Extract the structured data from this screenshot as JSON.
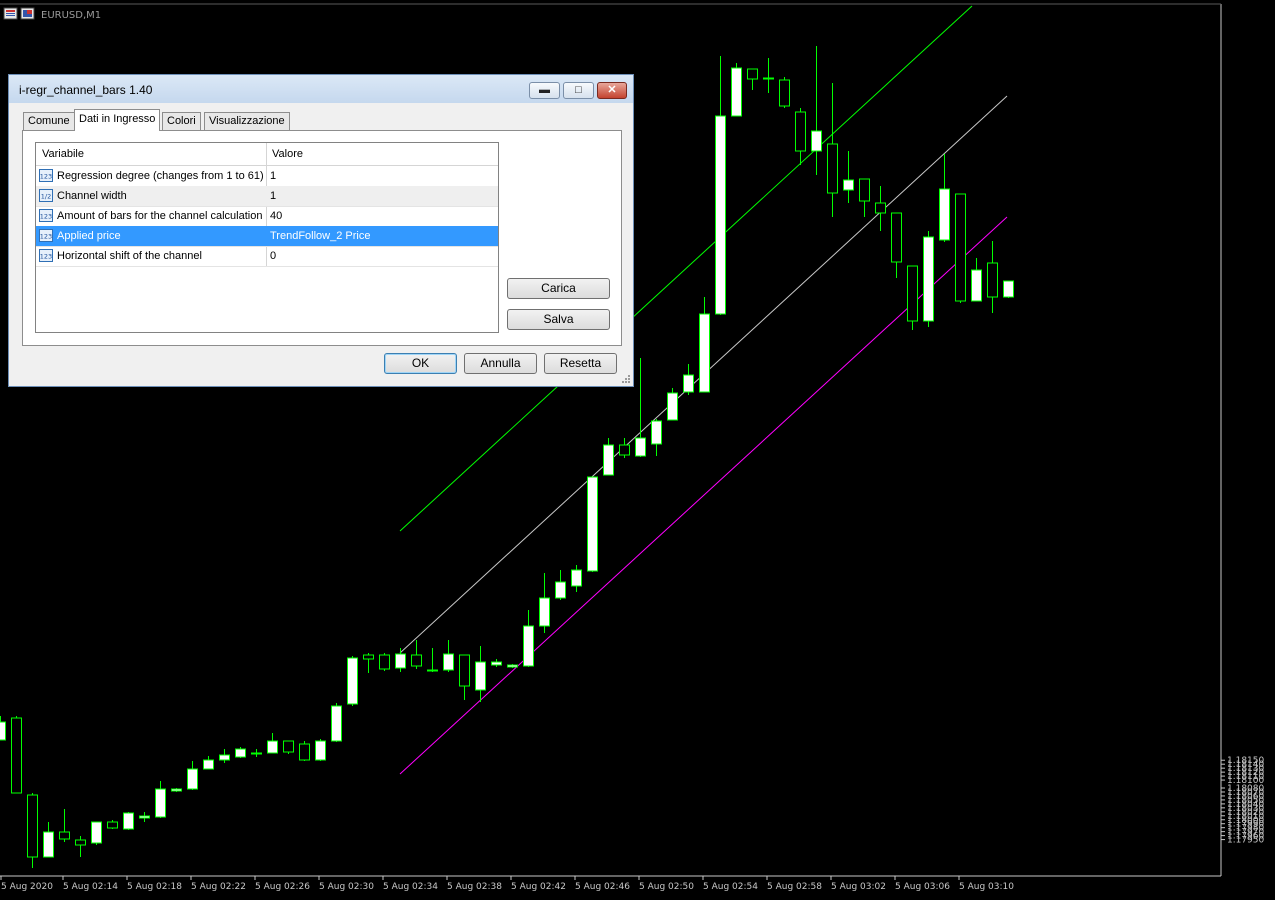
{
  "chart": {
    "symbol": "EURUSD,M1",
    "price_labels": [
      "1.18150",
      "1.18140",
      "1.18130",
      "1.18120",
      "1.18110",
      "1.18100",
      "1.18080",
      "1.18070",
      "1.18060",
      "1.18050",
      "1.18040",
      "1.18030",
      "1.18020",
      "1.18010",
      "1.18000",
      "1.17990",
      "1.17980",
      "1.17970",
      "1.17960",
      "1.17950"
    ],
    "time_labels": [
      "5 Aug 2020",
      "5 Aug 02:14",
      "5 Aug 02:18",
      "5 Aug 02:22",
      "5 Aug 02:26",
      "5 Aug 02:30",
      "5 Aug 02:34",
      "5 Aug 02:38",
      "5 Aug 02:42",
      "5 Aug 02:46",
      "5 Aug 02:50",
      "5 Aug 02:54",
      "5 Aug 02:58",
      "5 Aug 03:02",
      "5 Aug 03:06",
      "5 Aug 03:10"
    ],
    "colors": {
      "background": "#000000",
      "bull_body": "#ffffff",
      "bear_body": "#000000",
      "wick": "#00ff00",
      "channel_upper": "#00ff00",
      "channel_middle": "#c8c8c8",
      "channel_lower": "#ff00ff",
      "axis": "#c8c8c8"
    }
  },
  "dialog": {
    "title": "i-regr_channel_bars 1.40",
    "tabs": [
      {
        "label": "Comune"
      },
      {
        "label": "Dati in Ingresso"
      },
      {
        "label": "Colori"
      },
      {
        "label": "Visualizzazione"
      }
    ],
    "active_tab": "Dati in Ingresso",
    "table": {
      "headers": [
        "Variabile",
        "Valore"
      ],
      "rows": [
        {
          "icon": "123",
          "name": "Regression degree (changes from 1 to 61)",
          "value": "1"
        },
        {
          "icon": "1/2",
          "name": "Channel width",
          "value": "1"
        },
        {
          "icon": "123",
          "name": "Amount of bars for the channel calculation",
          "value": "40"
        },
        {
          "icon": "123",
          "name": "Applied price",
          "value": "TrendFollow_2 Price"
        },
        {
          "icon": "123",
          "name": "Horizontal shift of the channel",
          "value": "0"
        }
      ],
      "selected_row": "Applied price"
    },
    "buttons": {
      "load": "Carica",
      "save": "Salva",
      "ok": "OK",
      "cancel": "Annulla",
      "reset": "Resetta"
    }
  }
}
